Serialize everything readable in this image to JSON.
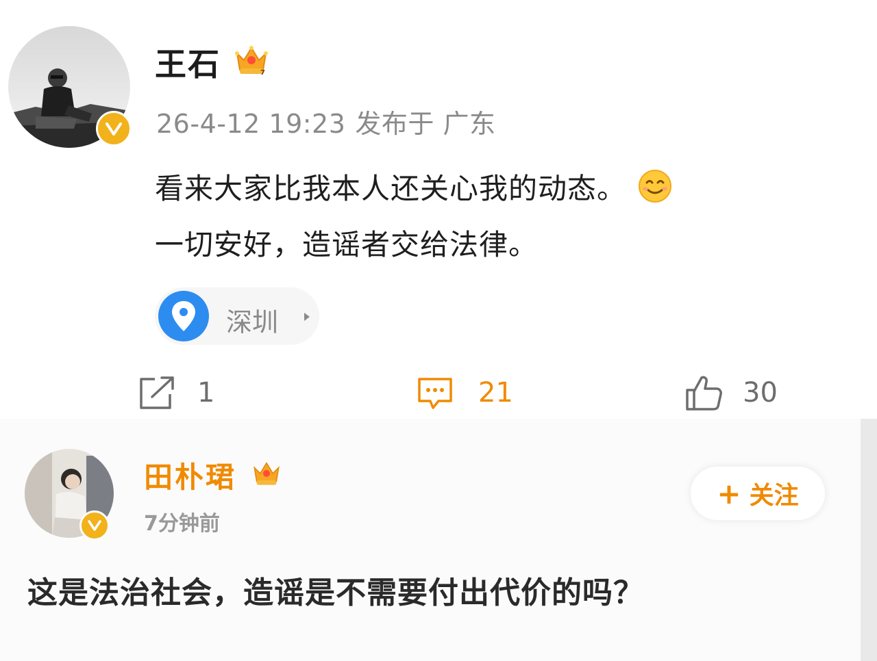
{
  "post": {
    "author": {
      "name": "王石",
      "verified": true,
      "badge": "crown-badge"
    },
    "timestamp": "26-4-12 19:23",
    "published_in": "发布于 广东",
    "content": {
      "line1": "看来大家比我本人还关心我的动态。",
      "line2": "一切安好，造谣者交给法律。",
      "emoji": "smile-emoji"
    },
    "location": {
      "name": "深圳"
    },
    "stats": {
      "reposts": "1",
      "comments": "21",
      "likes": "30"
    }
  },
  "comment": {
    "author": {
      "name": "田朴珺",
      "verified": true
    },
    "time": "7分钟前",
    "follow_label": "关注",
    "follow_plus": "+",
    "text": "这是法治社会，造谣是不需要付出代价的吗？"
  },
  "colors": {
    "accent_orange": "#f08a00",
    "verified_gold": "#f2b21b",
    "location_blue": "#2d8cf0",
    "meta_gray": "#8a8a8a"
  }
}
